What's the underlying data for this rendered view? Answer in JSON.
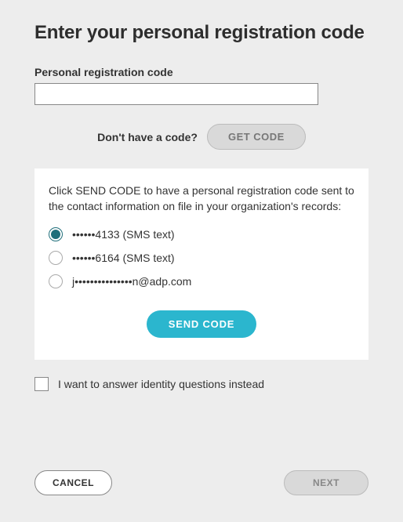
{
  "title": "Enter your personal registration code",
  "field": {
    "label": "Personal registration code",
    "value": ""
  },
  "codeRow": {
    "prompt": "Don't have a code?",
    "getCodeLabel": "GET CODE"
  },
  "panel": {
    "instruction": "Click SEND CODE to have a personal registration code sent to the contact information on file in your organization's records:",
    "options": [
      {
        "label": "••••••4133 (SMS text)",
        "selected": true
      },
      {
        "label": "••••••6164 (SMS text)",
        "selected": false
      },
      {
        "label": "j•••••••••••••••n@adp.com",
        "selected": false
      }
    ],
    "sendLabel": "SEND CODE"
  },
  "checkbox": {
    "label": "I want to answer identity questions instead",
    "checked": false
  },
  "footer": {
    "cancel": "CANCEL",
    "next": "NEXT"
  }
}
